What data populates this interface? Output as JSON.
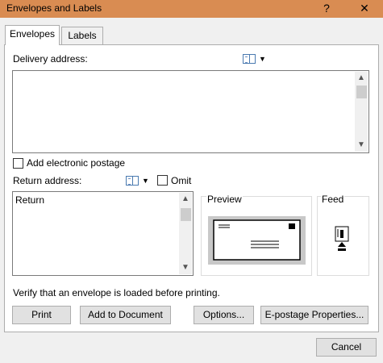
{
  "window": {
    "title": "Envelopes and Labels",
    "help_glyph": "?",
    "close_glyph": "✕"
  },
  "tabs": [
    {
      "label": "Envelopes",
      "active": true
    },
    {
      "label": "Labels",
      "active": false
    }
  ],
  "delivery": {
    "label": "Delivery address:",
    "value": ""
  },
  "electronic_postage": {
    "label": "Add electronic postage",
    "checked": false
  },
  "return": {
    "label": "Return address:",
    "value": "Return",
    "omit_label": "Omit",
    "omit_checked": false
  },
  "preview": {
    "title": "Preview"
  },
  "feed": {
    "title": "Feed"
  },
  "notice": "Verify that an envelope is loaded before printing.",
  "buttons": {
    "print": "Print",
    "add_to_document": "Add to Document",
    "options": "Options...",
    "epostage": "E-postage Properties...",
    "cancel": "Cancel"
  },
  "icons": {
    "address_book": "address-book-icon",
    "dropdown": "chevron-down-icon",
    "scroll_up": "▲",
    "scroll_down": "▼"
  },
  "colors": {
    "titlebar": "#d98c52",
    "dialog_bg": "#f0f0f0"
  }
}
